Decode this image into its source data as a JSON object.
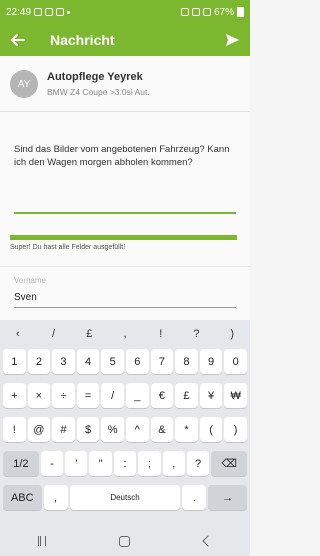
{
  "status_bar": {
    "time": "22:49",
    "battery": "67%"
  },
  "app_bar": {
    "title": "Nachricht",
    "back_icon": "arrow-left-icon",
    "send_icon": "send-icon"
  },
  "dealer": {
    "initials": "AY",
    "name": "Autopflege Yeyrek",
    "car": "BMW Z4 Coupe >3.0si Aut."
  },
  "message": {
    "text": "Sind das Bilder vom angebotenen Fahrzeug? Kann ich den Wagen morgen abholen kommen?"
  },
  "form": {
    "progress_percent": 100,
    "success_text": "Super! Du hast alle Felder ausgefüllt!",
    "vorname_label": "Vorname",
    "vorname_value": "Sven"
  },
  "keyboard": {
    "toolbar": [
      "‹",
      "/",
      "£",
      ",",
      "!",
      "?",
      ")"
    ],
    "rows": [
      [
        "1",
        "2",
        "3",
        "4",
        "5",
        "6",
        "7",
        "8",
        "9",
        "0"
      ],
      [
        "+",
        "×",
        "÷",
        "=",
        "/",
        "_",
        "€",
        "£",
        "¥",
        "₩"
      ],
      [
        "!",
        "@",
        "#",
        "$",
        "%",
        "^",
        "&",
        "*",
        "(",
        ")"
      ],
      [
        "1/2",
        "-",
        "'",
        "\"",
        ":",
        ";",
        ",",
        "?",
        "⌫"
      ],
      [
        "ABC",
        ",",
        "Deutsch",
        ".",
        "→"
      ]
    ]
  },
  "nav_bar": {
    "recent_icon": "recent-apps-icon",
    "home_icon": "home-icon",
    "back_icon": "back-icon"
  }
}
